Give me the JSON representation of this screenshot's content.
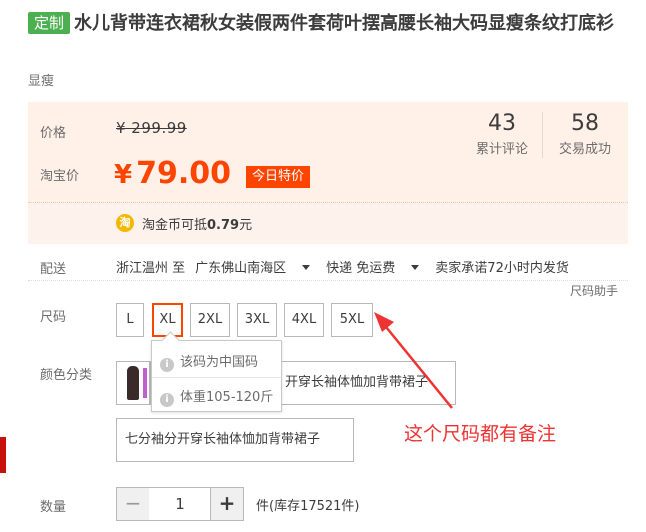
{
  "product": {
    "tag": "定制",
    "title": "水儿背带连衣裙秋女装假两件套荷叶摆高腰长袖大码显瘦条纹打底衫",
    "subtitle": "显瘦"
  },
  "price": {
    "label": "价格",
    "original": "¥ 299.99",
    "promo_label": "淘宝价",
    "currency": "¥",
    "current": "79.00",
    "promo_badge": "今日特价",
    "coin_icon_text": "淘",
    "coin_text": "淘金币可抵",
    "coin_amount": "0.79",
    "coin_unit": "元"
  },
  "stats": {
    "reviews_count": "43",
    "reviews_label": "累计评论",
    "sales_count": "58",
    "sales_label": "交易成功"
  },
  "shipping": {
    "label": "配送",
    "origin": "浙江温州 至",
    "destination": "广东佛山南海区",
    "method": "快递 免运费",
    "promise": "卖家承诺72小时内发货",
    "size_helper": "尺码助手"
  },
  "size": {
    "label": "尺码",
    "options": [
      "L",
      "XL",
      "2XL",
      "3XL",
      "4XL",
      "5XL"
    ],
    "selected": "XL",
    "tooltip_line1": "该码为中国码",
    "tooltip_line2": "体重105-120斤"
  },
  "color": {
    "label": "颜色分类",
    "option1": "开穿长袖体恤加背带裙子",
    "option2": "七分袖分开穿长袖体恤加背带裙子"
  },
  "annotation": "这个尺码都有备注",
  "quantity": {
    "label": "数量",
    "minus": "−",
    "value": "1",
    "plus": "+",
    "stock": "件(库存17521件)"
  },
  "colors": {
    "accent": "#ff4400",
    "tag_green": "#4caf50",
    "annotation_red": "#ee3333"
  }
}
